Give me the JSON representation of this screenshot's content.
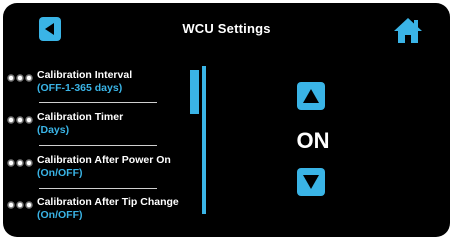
{
  "header": {
    "title": "WCU Settings",
    "back_icon": "back-arrow-icon",
    "home_icon": "home-icon"
  },
  "colors": {
    "accent": "#3ab4e6",
    "background": "#000000",
    "text": "#ffffff"
  },
  "menu": {
    "items": [
      {
        "label": "Calibration Interval",
        "sub": "(OFF-1-365 days)"
      },
      {
        "label": "Calibration Timer",
        "sub": "(Days)"
      },
      {
        "label": "Calibration After Power On",
        "sub": "(On/OFF)"
      },
      {
        "label": "Calibration After Tip Change",
        "sub": "(On/OFF)"
      }
    ]
  },
  "setting": {
    "value": "ON",
    "up_icon": "triangle-up-icon",
    "down_icon": "triangle-down-icon"
  }
}
